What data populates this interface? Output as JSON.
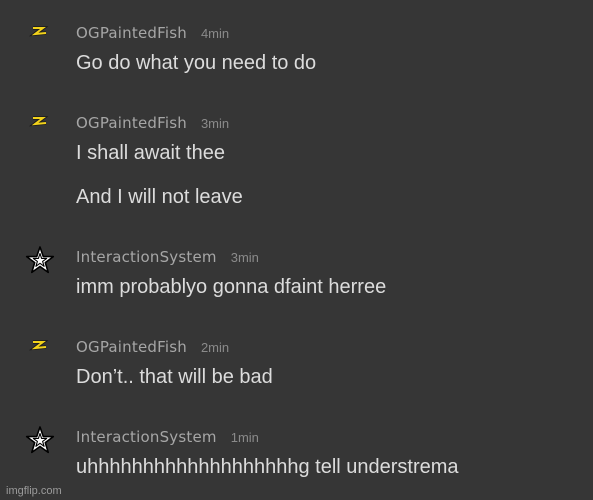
{
  "messages": [
    {
      "avatar_icon": "lightning-bolt-icon",
      "username": "OGPaintedFish",
      "time": "4min",
      "lines": [
        "Go do what you need to do"
      ]
    },
    {
      "avatar_icon": "lightning-bolt-icon",
      "username": "OGPaintedFish",
      "time": "3min",
      "lines": [
        "I shall await thee",
        "And I will not leave"
      ]
    },
    {
      "avatar_icon": "star-icon",
      "username": "InteractionSystem",
      "time": "3min",
      "lines": [
        "imm probablyo gonna dfaint herree"
      ]
    },
    {
      "avatar_icon": "lightning-bolt-icon",
      "username": "OGPaintedFish",
      "time": "2min",
      "lines": [
        "Don’t.. that will be bad"
      ]
    },
    {
      "avatar_icon": "star-icon",
      "username": "InteractionSystem",
      "time": "1min",
      "lines": [
        "uhhhhhhhhhhhhhhhhhhhg tell understrema"
      ]
    }
  ],
  "watermark": "imgflip.com",
  "colors": {
    "background": "#363636",
    "username": "#a6a6a6",
    "timestamp": "#8a8a8a",
    "message_text": "#dcdcdc",
    "bolt": "#f2d21b"
  }
}
